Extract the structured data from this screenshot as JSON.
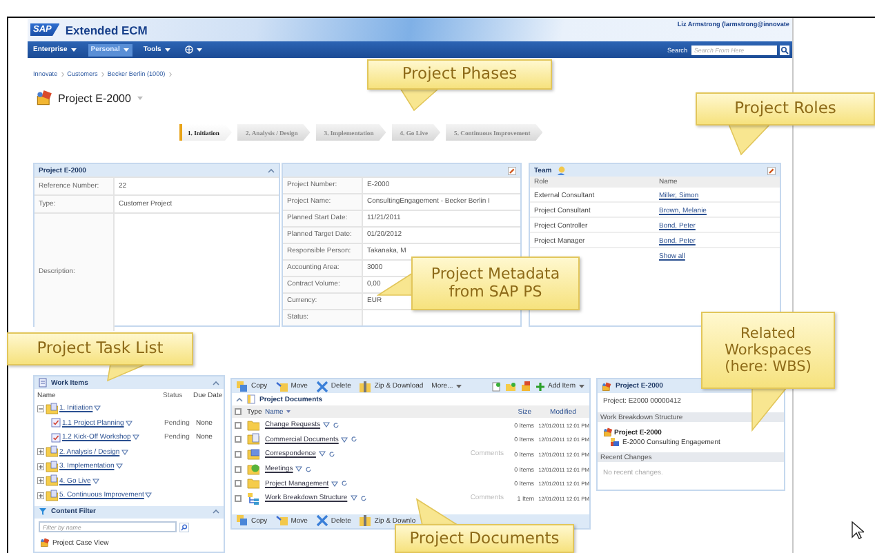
{
  "header": {
    "logo": "SAP",
    "product": "Extended ECM",
    "user": "Liz Armstrong (larmstrong@innovate"
  },
  "nav": {
    "menus": [
      {
        "label": "Enterprise",
        "selected": false
      },
      {
        "label": "Personal",
        "selected": true
      },
      {
        "label": "Tools",
        "selected": false
      }
    ],
    "search_label": "Search",
    "search_placeholder": "Search From Here"
  },
  "breadcrumb": [
    "Innovate",
    "Customers",
    "Becker Berlin (1000)"
  ],
  "title": "Project E-2000",
  "phases": [
    {
      "label": "1. Initiation",
      "selected": true
    },
    {
      "label": "2. Analysis / Design",
      "selected": false
    },
    {
      "label": "3. Implementation",
      "selected": false
    },
    {
      "label": "4. Go Live",
      "selected": false
    },
    {
      "label": "5. Continuous Improvement",
      "selected": false
    }
  ],
  "project_panel": {
    "title": "Project E-2000",
    "fields": [
      {
        "label": "Reference Number:",
        "value": "22"
      },
      {
        "label": "Type:",
        "value": "Customer Project"
      },
      {
        "label": "Description:"
      }
    ]
  },
  "metadata_panel": {
    "fields": [
      {
        "label": "Project Number:",
        "value": "E-2000"
      },
      {
        "label": "Project Name:",
        "value": "ConsultingEngagement - Becker Berlin I"
      },
      {
        "label": "Planned Start Date:",
        "value": "11/21/2011"
      },
      {
        "label": "Planned Target Date:",
        "value": "01/20/2012"
      },
      {
        "label": "Responsible Person:",
        "value": "Takanaka, M"
      },
      {
        "label": "Accounting Area:",
        "value": "3000"
      },
      {
        "label": "Contract Volume:",
        "value": "0,00"
      },
      {
        "label": "Currency:",
        "value": "EUR"
      },
      {
        "label": "Status:"
      }
    ]
  },
  "team": {
    "title": "Team",
    "columns": [
      "Role",
      "Name"
    ],
    "rows": [
      {
        "role": "External Consultant",
        "name": "Miller, Simon"
      },
      {
        "role": "Project Consultant",
        "name": "Brown, Melanie"
      },
      {
        "role": "Project Controller",
        "name": "Bond, Peter"
      },
      {
        "role": "Project Manager",
        "name": "Bond, Peter"
      }
    ],
    "show_all": "Show all"
  },
  "work_items": {
    "title": "Work Items",
    "columns": [
      "Name",
      "Status",
      "Due Date"
    ],
    "items": [
      {
        "label": "1. Initiation",
        "expanded": true,
        "children": [
          {
            "label": "1.1 Project Planning",
            "status": "Pending",
            "due_date": "None"
          },
          {
            "label": "1.2 Kick-Off Workshop",
            "status": "Pending",
            "due_date": "None"
          }
        ]
      },
      {
        "label": "2. Analysis / Design",
        "expanded": false
      },
      {
        "label": "3. Implementation",
        "expanded": false
      },
      {
        "label": "4. Go Live",
        "expanded": false
      },
      {
        "label": "5. Continuous Improvement",
        "expanded": false
      }
    ]
  },
  "content_filter": {
    "title": "Content Filter",
    "placeholder": "Filter by name",
    "items": [
      "Project Case View"
    ]
  },
  "documents": {
    "toolbar": [
      {
        "label": "Copy",
        "kind": "copy"
      },
      {
        "label": "Move",
        "kind": "move"
      },
      {
        "label": "Delete",
        "kind": "delete"
      },
      {
        "label": "Zip & Download",
        "kind": "zip"
      },
      {
        "label": "More...",
        "kind": "more"
      }
    ],
    "add_item": "Add Item",
    "title": "Project Documents",
    "select_all_checked": false,
    "columns": [
      "Type",
      "Name",
      "Size",
      "Modified"
    ],
    "rows": [
      {
        "kind": "folder",
        "name": "Change Requests",
        "size": "0 Items",
        "modified": "12/01/2011 12:01 PM",
        "checked": false
      },
      {
        "kind": "document-folder",
        "name": "Commercial Documents",
        "size": "0 Items",
        "modified": "12/01/2011 12:01 PM",
        "checked": false
      },
      {
        "kind": "mail-folder",
        "name": "Correspondence",
        "comments": "Comments",
        "size": "0 Items",
        "modified": "12/01/2011 12:01 PM",
        "checked": false
      },
      {
        "kind": "meeting-folder",
        "name": "Meetings",
        "size": "0 Items",
        "modified": "12/01/2011 12:01 PM",
        "checked": false
      },
      {
        "kind": "folder",
        "name": "Project Management",
        "size": "0 Items",
        "modified": "12/01/2011 12:01 PM",
        "checked": false
      },
      {
        "kind": "wbs",
        "name": "Work Breakdown Structure",
        "comments": "Comments",
        "size": "1 Item",
        "modified": "12/01/2011 12:01 PM",
        "checked": false
      }
    ],
    "bottom_toolbar": [
      {
        "label": "Copy",
        "kind": "copy"
      },
      {
        "label": "Move",
        "kind": "move"
      },
      {
        "label": "Delete",
        "kind": "delete"
      },
      {
        "label": "Zip & Downlo",
        "kind": "zip"
      }
    ]
  },
  "related": {
    "title": "Project E-2000",
    "project": "Project: E2000 00000412",
    "wbs_title": "Work Breakdown Structure",
    "wbs": [
      {
        "label": "Project E-2000",
        "children": [
          {
            "label": "E-2000 Consulting Engagement"
          }
        ]
      }
    ],
    "recent_title": "Recent Changes",
    "recent_empty": "No recent changes."
  },
  "callouts": [
    {
      "text": "Project Phases"
    },
    {
      "text": "Project Roles"
    },
    {
      "text": "Project Metadata from SAP PS"
    },
    {
      "text": "Project Task List"
    },
    {
      "text": "Related Workspaces (here: WBS)"
    },
    {
      "text": "Project Documents"
    }
  ]
}
